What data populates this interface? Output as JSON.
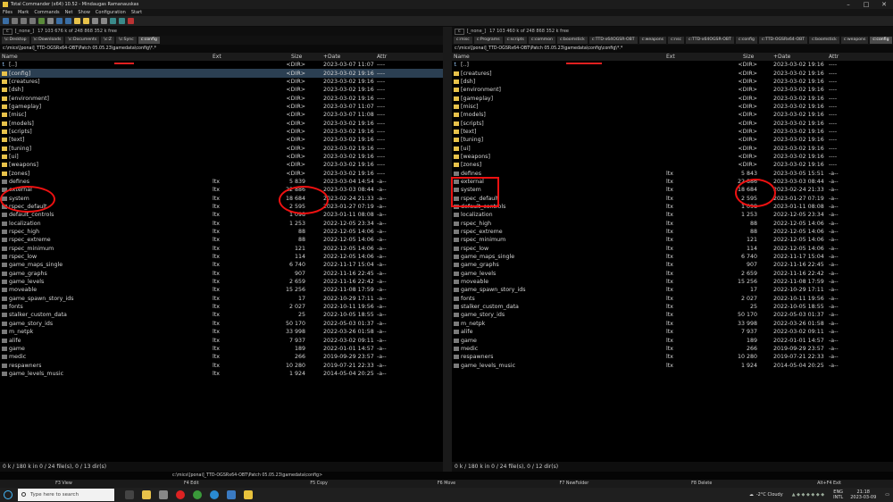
{
  "window": {
    "title": "Total Commander (x64) 10.52 - Mindaugas Ramanauskas",
    "minimize": "–",
    "maximize": "□",
    "close": "✕"
  },
  "menu": [
    "Files",
    "Mark",
    "Commands",
    "Net",
    "Show",
    "Configuration",
    "Start"
  ],
  "left": {
    "drive": "c",
    "drive_label": "[_none_]",
    "free": "17 103 676 k of 248 868 352 k free",
    "tabs": [
      "\\c:Desktop",
      "\\c:Downloads",
      "\\c:Documents",
      "\\c:Z",
      "\\c:Sync",
      "c:config"
    ],
    "active_tab": 5,
    "path": "c:\\mics\\[ponai]_TTD-OGSRx64-OBT\\Patch 05.05.23\\gamedata\\config\\*.*",
    "columns": {
      "name": "Name",
      "ext": "Ext",
      "size": "Size",
      "date": "+Date",
      "attr": "Attr"
    },
    "status": "0 k / 180 k in 0 / 24 file(s), 0 / 13 dir(s)",
    "rows": [
      {
        "type": "up",
        "name": "[..]",
        "ext": "",
        "size": "<DIR>",
        "date": "2023-03-07 11:07",
        "attr": "----"
      },
      {
        "type": "folder",
        "name": "[config]",
        "ext": "",
        "size": "<DIR>",
        "date": "2023-03-02 19:16",
        "attr": "----"
      },
      {
        "type": "folder",
        "name": "[creatures]",
        "ext": "",
        "size": "<DIR>",
        "date": "2023-03-02 19:16",
        "attr": "----"
      },
      {
        "type": "folder",
        "name": "[dsh]",
        "ext": "",
        "size": "<DIR>",
        "date": "2023-03-02 19:16",
        "attr": "----"
      },
      {
        "type": "folder",
        "name": "[environment]",
        "ext": "",
        "size": "<DIR>",
        "date": "2023-03-02 19:16",
        "attr": "----"
      },
      {
        "type": "folder",
        "name": "[gameplay]",
        "ext": "",
        "size": "<DIR>",
        "date": "2023-03-07 11:07",
        "attr": "----"
      },
      {
        "type": "folder",
        "name": "[misc]",
        "ext": "",
        "size": "<DIR>",
        "date": "2023-03-07 11:08",
        "attr": "----"
      },
      {
        "type": "folder",
        "name": "[models]",
        "ext": "",
        "size": "<DIR>",
        "date": "2023-03-02 19:16",
        "attr": "----"
      },
      {
        "type": "folder",
        "name": "[scripts]",
        "ext": "",
        "size": "<DIR>",
        "date": "2023-03-02 19:16",
        "attr": "----"
      },
      {
        "type": "folder",
        "name": "[text]",
        "ext": "",
        "size": "<DIR>",
        "date": "2023-03-02 19:16",
        "attr": "----"
      },
      {
        "type": "folder",
        "name": "[tuning]",
        "ext": "",
        "size": "<DIR>",
        "date": "2023-03-02 19:16",
        "attr": "----"
      },
      {
        "type": "folder",
        "name": "[ui]",
        "ext": "",
        "size": "<DIR>",
        "date": "2023-03-02 19:16",
        "attr": "----"
      },
      {
        "type": "folder",
        "name": "[weapons]",
        "ext": "",
        "size": "<DIR>",
        "date": "2023-03-02 19:16",
        "attr": "----"
      },
      {
        "type": "folder",
        "name": "[zones]",
        "ext": "",
        "size": "<DIR>",
        "date": "2023-03-02 19:16",
        "attr": "----"
      },
      {
        "type": "file",
        "name": "defines",
        "ext": "ltx",
        "size": "5 839",
        "date": "2023-03-04 14:54",
        "attr": "-a--"
      },
      {
        "type": "file",
        "name": "external",
        "ext": "ltx",
        "size": "22 886",
        "date": "2023-03-03 08:44",
        "attr": "-a--"
      },
      {
        "type": "file",
        "name": "system",
        "ext": "ltx",
        "size": "18 684",
        "date": "2023-02-24 21:33",
        "attr": "-a--"
      },
      {
        "type": "file",
        "name": "rspec_default",
        "ext": "ltx",
        "size": "2 595",
        "date": "2023-01-27 07:19",
        "attr": "-a--"
      },
      {
        "type": "file",
        "name": "default_controls",
        "ext": "ltx",
        "size": "1 098",
        "date": "2023-01-11 08:08",
        "attr": "-a--"
      },
      {
        "type": "file",
        "name": "localization",
        "ext": "ltx",
        "size": "1 253",
        "date": "2022-12-05 23:34",
        "attr": "-a--"
      },
      {
        "type": "file",
        "name": "rspec_high",
        "ext": "ltx",
        "size": "88",
        "date": "2022-12-05 14:06",
        "attr": "-a--"
      },
      {
        "type": "file",
        "name": "rspec_extreme",
        "ext": "ltx",
        "size": "88",
        "date": "2022-12-05 14:06",
        "attr": "-a--"
      },
      {
        "type": "file",
        "name": "rspec_minimum",
        "ext": "ltx",
        "size": "121",
        "date": "2022-12-05 14:06",
        "attr": "-a--"
      },
      {
        "type": "file",
        "name": "rspec_low",
        "ext": "ltx",
        "size": "114",
        "date": "2022-12-05 14:06",
        "attr": "-a--"
      },
      {
        "type": "file",
        "name": "game_maps_single",
        "ext": "ltx",
        "size": "6 740",
        "date": "2022-11-17 15:04",
        "attr": "-a--"
      },
      {
        "type": "file",
        "name": "game_graphs",
        "ext": "ltx",
        "size": "907",
        "date": "2022-11-16 22:45",
        "attr": "-a--"
      },
      {
        "type": "file",
        "name": "game_levels",
        "ext": "ltx",
        "size": "2 659",
        "date": "2022-11-16 22:42",
        "attr": "-a--"
      },
      {
        "type": "file",
        "name": "moveable",
        "ext": "ltx",
        "size": "15 256",
        "date": "2022-11-08 17:59",
        "attr": "-a--"
      },
      {
        "type": "file",
        "name": "game_spawn_story_ids",
        "ext": "ltx",
        "size": "17",
        "date": "2022-10-29 17:11",
        "attr": "-a--"
      },
      {
        "type": "file",
        "name": "fonts",
        "ext": "ltx",
        "size": "2 027",
        "date": "2022-10-11 19:56",
        "attr": "-a--"
      },
      {
        "type": "file",
        "name": "stalker_custom_data",
        "ext": "ltx",
        "size": "25",
        "date": "2022-10-05 18:55",
        "attr": "-a--"
      },
      {
        "type": "file",
        "name": "game_story_ids",
        "ext": "ltx",
        "size": "50 170",
        "date": "2022-05-03 01:37",
        "attr": "-a--"
      },
      {
        "type": "file",
        "name": "m_netpk",
        "ext": "ltx",
        "size": "33 998",
        "date": "2022-03-26 01:58",
        "attr": "-a--"
      },
      {
        "type": "file",
        "name": "alife",
        "ext": "ltx",
        "size": "7 937",
        "date": "2022-03-02 09:11",
        "attr": "-a--"
      },
      {
        "type": "file",
        "name": "game",
        "ext": "ltx",
        "size": "189",
        "date": "2022-01-01 14:57",
        "attr": "-a--"
      },
      {
        "type": "file",
        "name": "medic",
        "ext": "ltx",
        "size": "266",
        "date": "2019-09-29 23:57",
        "attr": "-a--"
      },
      {
        "type": "file",
        "name": "respawners",
        "ext": "ltx",
        "size": "10 280",
        "date": "2019-07-21 22:33",
        "attr": "-a--"
      },
      {
        "type": "file",
        "name": "game_levels_music",
        "ext": "ltx",
        "size": "1 924",
        "date": "2014-05-04 20:25",
        "attr": "-a--"
      }
    ]
  },
  "right": {
    "drive": "c",
    "drive_label": "[_none_]",
    "free": "17 103 460 k of 248 868 352 k free",
    "tabs": [
      "c:misc",
      "c:Programs",
      "c:scripts",
      "c:common",
      "c:boomstick",
      "c:TTD-x64OGSR-OBT",
      "c:weapons",
      "c:nsc",
      "c:TTD-x64OGSR-OBT",
      "c:config",
      "c:TTD-OGSRx64-OBT",
      "c:boomstick",
      "c:weapons",
      "c:config",
      "c:config"
    ],
    "active_tab": 13,
    "path": "c:\\mics\\[ponai]_TTD-OGSRx64-OBT\\Patch 05.05.23\\gamedata\\config\\config\\*.*",
    "columns": {
      "name": "Name",
      "ext": "Ext",
      "size": "Size",
      "date": "+Date",
      "attr": "Attr"
    },
    "status": "0 k / 180 k in 0 / 24 file(s), 0 / 12 dir(s)",
    "rows": [
      {
        "type": "up",
        "name": "[..]",
        "ext": "",
        "size": "<DIR>",
        "date": "2023-03-02 19:16",
        "attr": "----"
      },
      {
        "type": "folder",
        "name": "[creatures]",
        "ext": "",
        "size": "<DIR>",
        "date": "2023-03-02 19:16",
        "attr": "----"
      },
      {
        "type": "folder",
        "name": "[dsh]",
        "ext": "",
        "size": "<DIR>",
        "date": "2023-03-02 19:16",
        "attr": "----"
      },
      {
        "type": "folder",
        "name": "[environment]",
        "ext": "",
        "size": "<DIR>",
        "date": "2023-03-02 19:16",
        "attr": "----"
      },
      {
        "type": "folder",
        "name": "[gameplay]",
        "ext": "",
        "size": "<DIR>",
        "date": "2023-03-02 19:16",
        "attr": "----"
      },
      {
        "type": "folder",
        "name": "[misc]",
        "ext": "",
        "size": "<DIR>",
        "date": "2023-03-02 19:16",
        "attr": "----"
      },
      {
        "type": "folder",
        "name": "[models]",
        "ext": "",
        "size": "<DIR>",
        "date": "2023-03-02 19:16",
        "attr": "----"
      },
      {
        "type": "folder",
        "name": "[scripts]",
        "ext": "",
        "size": "<DIR>",
        "date": "2023-03-02 19:16",
        "attr": "----"
      },
      {
        "type": "folder",
        "name": "[text]",
        "ext": "",
        "size": "<DIR>",
        "date": "2023-03-02 19:16",
        "attr": "----"
      },
      {
        "type": "folder",
        "name": "[tuning]",
        "ext": "",
        "size": "<DIR>",
        "date": "2023-03-02 19:16",
        "attr": "----"
      },
      {
        "type": "folder",
        "name": "[ui]",
        "ext": "",
        "size": "<DIR>",
        "date": "2023-03-02 19:16",
        "attr": "----"
      },
      {
        "type": "folder",
        "name": "[weapons]",
        "ext": "",
        "size": "<DIR>",
        "date": "2023-03-02 19:16",
        "attr": "----"
      },
      {
        "type": "folder",
        "name": "[zones]",
        "ext": "",
        "size": "<DIR>",
        "date": "2023-03-02 19:16",
        "attr": "----"
      },
      {
        "type": "file",
        "name": "defines",
        "ext": "ltx",
        "size": "5 843",
        "date": "2023-03-05 15:51",
        "attr": "-a--"
      },
      {
        "type": "file",
        "name": "external",
        "ext": "ltx",
        "size": "22 886",
        "date": "2023-03-03 08:44",
        "attr": "-a--"
      },
      {
        "type": "file",
        "name": "system",
        "ext": "ltx",
        "size": "18 684",
        "date": "2023-02-24 21:33",
        "attr": "-a--"
      },
      {
        "type": "file",
        "name": "rspec_default",
        "ext": "ltx",
        "size": "2 595",
        "date": "2023-01-27 07:19",
        "attr": "-a--"
      },
      {
        "type": "file",
        "name": "default_controls",
        "ext": "ltx",
        "size": "1 098",
        "date": "2023-01-11 08:08",
        "attr": "-a--"
      },
      {
        "type": "file",
        "name": "localization",
        "ext": "ltx",
        "size": "1 253",
        "date": "2022-12-05 23:34",
        "attr": "-a--"
      },
      {
        "type": "file",
        "name": "rspec_high",
        "ext": "ltx",
        "size": "88",
        "date": "2022-12-05 14:06",
        "attr": "-a--"
      },
      {
        "type": "file",
        "name": "rspec_extreme",
        "ext": "ltx",
        "size": "88",
        "date": "2022-12-05 14:06",
        "attr": "-a--"
      },
      {
        "type": "file",
        "name": "rspec_minimum",
        "ext": "ltx",
        "size": "121",
        "date": "2022-12-05 14:06",
        "attr": "-a--"
      },
      {
        "type": "file",
        "name": "rspec_low",
        "ext": "ltx",
        "size": "114",
        "date": "2022-12-05 14:06",
        "attr": "-a--"
      },
      {
        "type": "file",
        "name": "game_maps_single",
        "ext": "ltx",
        "size": "6 740",
        "date": "2022-11-17 15:04",
        "attr": "-a--"
      },
      {
        "type": "file",
        "name": "game_graphs",
        "ext": "ltx",
        "size": "907",
        "date": "2022-11-16 22:45",
        "attr": "-a--"
      },
      {
        "type": "file",
        "name": "game_levels",
        "ext": "ltx",
        "size": "2 659",
        "date": "2022-11-16 22:42",
        "attr": "-a--"
      },
      {
        "type": "file",
        "name": "moveable",
        "ext": "ltx",
        "size": "15 256",
        "date": "2022-11-08 17:59",
        "attr": "-a--"
      },
      {
        "type": "file",
        "name": "game_spawn_story_ids",
        "ext": "ltx",
        "size": "17",
        "date": "2022-10-29 17:11",
        "attr": "-a--"
      },
      {
        "type": "file",
        "name": "fonts",
        "ext": "ltx",
        "size": "2 027",
        "date": "2022-10-11 19:56",
        "attr": "-a--"
      },
      {
        "type": "file",
        "name": "stalker_custom_data",
        "ext": "ltx",
        "size": "25",
        "date": "2022-10-05 18:55",
        "attr": "-a--"
      },
      {
        "type": "file",
        "name": "game_story_ids",
        "ext": "ltx",
        "size": "50 170",
        "date": "2022-05-03 01:37",
        "attr": "-a--"
      },
      {
        "type": "file",
        "name": "m_netpk",
        "ext": "ltx",
        "size": "33 998",
        "date": "2022-03-26 01:58",
        "attr": "-a--"
      },
      {
        "type": "file",
        "name": "alife",
        "ext": "ltx",
        "size": "7 937",
        "date": "2022-03-02 09:11",
        "attr": "-a--"
      },
      {
        "type": "file",
        "name": "game",
        "ext": "ltx",
        "size": "189",
        "date": "2022-01-01 14:57",
        "attr": "-a--"
      },
      {
        "type": "file",
        "name": "medic",
        "ext": "ltx",
        "size": "266",
        "date": "2019-09-29 23:57",
        "attr": "-a--"
      },
      {
        "type": "file",
        "name": "respawners",
        "ext": "ltx",
        "size": "10 280",
        "date": "2019-07-21 22:33",
        "attr": "-a--"
      },
      {
        "type": "file",
        "name": "game_levels_music",
        "ext": "ltx",
        "size": "1 924",
        "date": "2014-05-04 20:25",
        "attr": "-a--"
      }
    ]
  },
  "cmdline": "c:\\mics\\[ponai]_TTD-OGSRx64-OBT\\Patch 05.05.23\\gamedata\\config>",
  "fkeys": [
    "F3 View",
    "F4 Edit",
    "F5 Copy",
    "F6 Move",
    "F7 NewFolder",
    "F8 Delete",
    "Alt+F4 Exit"
  ],
  "taskbar": {
    "search_placeholder": "Type here to search",
    "weather": "-2°C  Cloudy",
    "lang": "ENG",
    "lang2": "INTL",
    "time": "21:18",
    "date": "2023-03-09"
  },
  "colors": {
    "folder": "#e8c24a",
    "annotation": "#e11111",
    "selection": "#2b3f52"
  }
}
